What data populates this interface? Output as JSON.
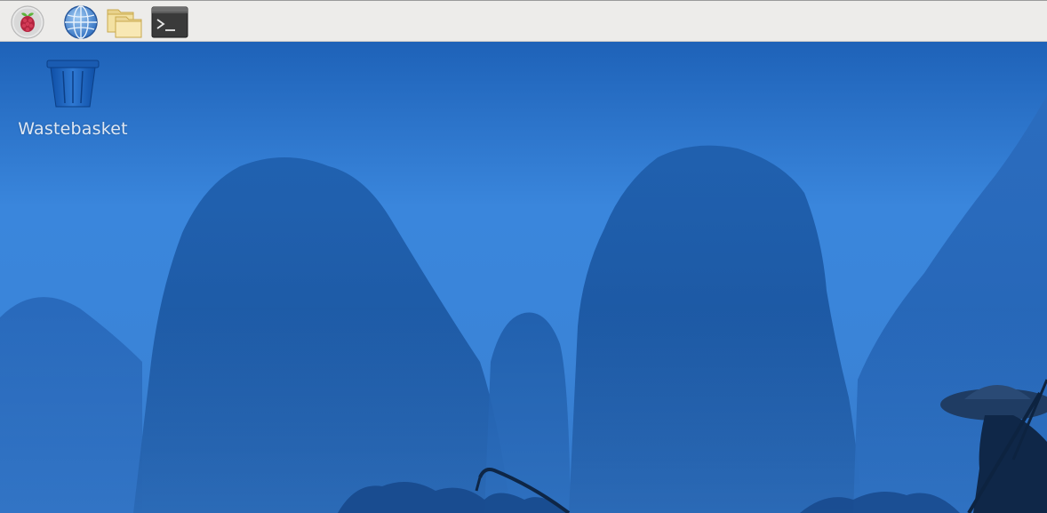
{
  "taskbar": {
    "launchers": [
      {
        "icon": "raspberry-menu-icon",
        "tooltip": ""
      },
      {
        "icon": "web-browser-icon",
        "tooltip": ""
      },
      {
        "icon": "file-manager-icon",
        "tooltip": ""
      },
      {
        "icon": "terminal-icon",
        "tooltip": ""
      }
    ]
  },
  "desktop": {
    "icons": [
      {
        "icon": "wastebasket-icon",
        "label": "Wastebasket"
      }
    ]
  },
  "colors": {
    "taskbar_bg": "#edecea",
    "sky": "#3f8be0",
    "mountain_dark": "#1b5aa6",
    "label_text": "#dfe8f4"
  }
}
